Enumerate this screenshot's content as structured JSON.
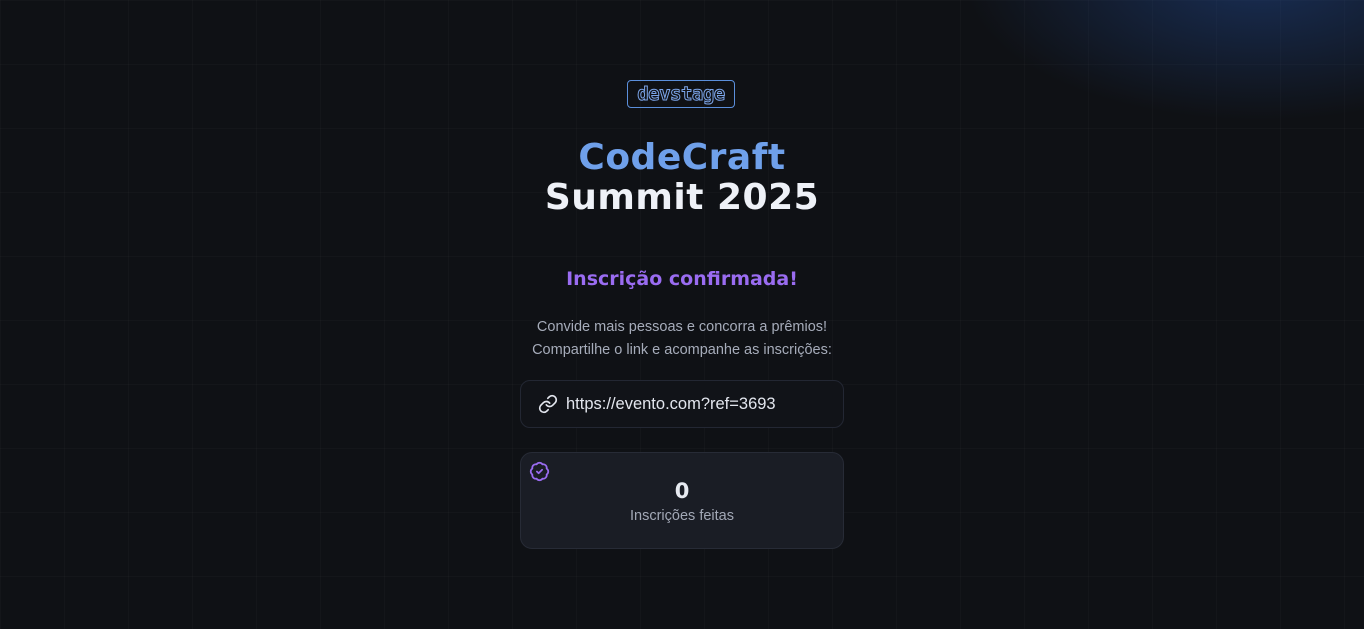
{
  "logo": {
    "text": "devstage"
  },
  "event": {
    "title_line1": "CodeCraft",
    "title_line2": "Summit 2025"
  },
  "confirmation": {
    "heading": "Inscrição confirmada!",
    "description_line1": "Convide mais pessoas e concorra a prêmios!",
    "description_line2": "Compartilhe o link e acompanhe as inscrições:"
  },
  "invite": {
    "link": "https://evento.com?ref=3693",
    "icon": "link-icon"
  },
  "stats": {
    "value": "0",
    "label": "Inscrições feitas",
    "icon": "badge-check-icon"
  },
  "colors": {
    "background": "#0f1115",
    "title_accent": "#6fa0ea",
    "title_main": "#eef1f7",
    "confirmed": "#9a6cf1",
    "logo_outline": "#7ba4e8",
    "card": "#1a1d25"
  }
}
